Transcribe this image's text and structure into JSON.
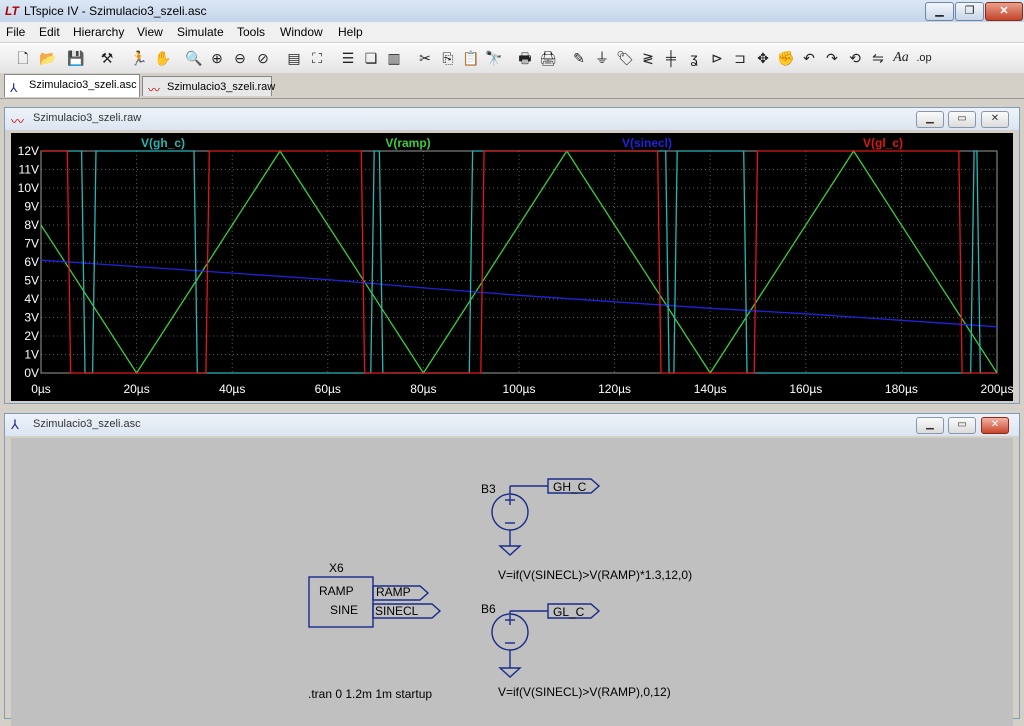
{
  "app": {
    "title": "LTspice IV - Szimulacio3_szeli.asc",
    "logo_text": "LT"
  },
  "menu": [
    "File",
    "Edit",
    "Hierarchy",
    "View",
    "Simulate",
    "Tools",
    "Window",
    "Help"
  ],
  "tabs": [
    {
      "label": "Szimulacio3_szeli.asc",
      "active": true
    },
    {
      "label": "Szimulacio3_szeli.raw",
      "active": false
    }
  ],
  "waveform_window": {
    "title": "Szimulacio3_szeli.raw"
  },
  "schematic_window": {
    "title": "Szimulacio3_szeli.asc",
    "components": {
      "b3": {
        "ref": "B3",
        "net": "GH_C",
        "expr": "V=if(V(SINECL)>V(RAMP)*1.3,12,0)"
      },
      "b6": {
        "ref": "B6",
        "net": "GL_C",
        "expr": "V=if(V(SINECL)>V(RAMP),0,12)"
      },
      "x6": {
        "ref": "X6",
        "pin1": "RAMP",
        "pin2": "SINE",
        "net1": "RAMP",
        "net2": "SINECL"
      }
    },
    "directive": ".tran 0 1.2m 1m startup"
  },
  "colors": {
    "plot_bg": "#000000",
    "grid": "#5a5a5a",
    "axis_text": "#ffffff",
    "gh_c": "#2ab5b5",
    "ramp": "#3ccc3c",
    "sinecl": "#2222dd",
    "gl_c": "#e01818",
    "schem_bg": "#c0c0c0",
    "wire": "#1a2a8a"
  },
  "chart_data": {
    "type": "line",
    "x_unit": "µs",
    "y_unit": "V",
    "xlim": [
      0,
      200
    ],
    "ylim": [
      0,
      12
    ],
    "xticks": [
      0,
      20,
      40,
      60,
      80,
      100,
      120,
      140,
      160,
      180,
      200
    ],
    "xtick_labels": [
      "0µs",
      "20µs",
      "40µs",
      "60µs",
      "80µs",
      "100µs",
      "120µs",
      "140µs",
      "160µs",
      "180µs",
      "200µs"
    ],
    "yticks": [
      0,
      1,
      2,
      3,
      4,
      5,
      6,
      7,
      8,
      9,
      10,
      11,
      12
    ],
    "ytick_labels": [
      "0V",
      "1V",
      "2V",
      "3V",
      "4V",
      "5V",
      "6V",
      "7V",
      "8V",
      "9V",
      "10V",
      "11V",
      "12V"
    ],
    "grid": true,
    "series": [
      {
        "name": "V(gh_c)",
        "color_key": "gh_c",
        "x": [
          0,
          8.5,
          9.2,
          10.8,
          11.5,
          32.0,
          32.7,
          69.0,
          69.7,
          70.8,
          71.5,
          89.6,
          90.3,
          130.7,
          131.4,
          132.4,
          133.1,
          147.0,
          147.7,
          194.5,
          195.2,
          195.8,
          196.5,
          200
        ],
        "y": [
          12,
          12,
          0,
          0,
          12,
          12,
          0,
          0,
          12,
          12,
          0,
          0,
          12,
          12,
          0,
          0,
          12,
          12,
          0,
          0,
          12,
          12,
          0,
          0
        ]
      },
      {
        "name": "V(ramp)",
        "color_key": "ramp",
        "x": [
          0,
          20,
          50,
          80,
          110,
          140,
          170,
          200
        ],
        "y": [
          8,
          0,
          12,
          0,
          12,
          0,
          12,
          0
        ]
      },
      {
        "name": "V(sinecl)",
        "color_key": "sinecl",
        "x": [
          0,
          20,
          40,
          60,
          80,
          100,
          120,
          140,
          160,
          180,
          200
        ],
        "y": [
          6.1,
          5.75,
          5.4,
          5.05,
          4.6,
          4.2,
          3.85,
          3.5,
          3.2,
          2.85,
          2.5
        ]
      },
      {
        "name": "V(gl_c)",
        "color_key": "gl_c",
        "x": [
          0,
          5.5,
          6.2,
          34.5,
          35.2,
          67.0,
          67.7,
          92.0,
          92.7,
          129.0,
          129.7,
          149.2,
          149.9,
          192.0,
          192.7,
          200
        ],
        "y": [
          12,
          12,
          0,
          0,
          12,
          12,
          0,
          0,
          12,
          12,
          0,
          0,
          12,
          12,
          0,
          0
        ]
      }
    ]
  }
}
